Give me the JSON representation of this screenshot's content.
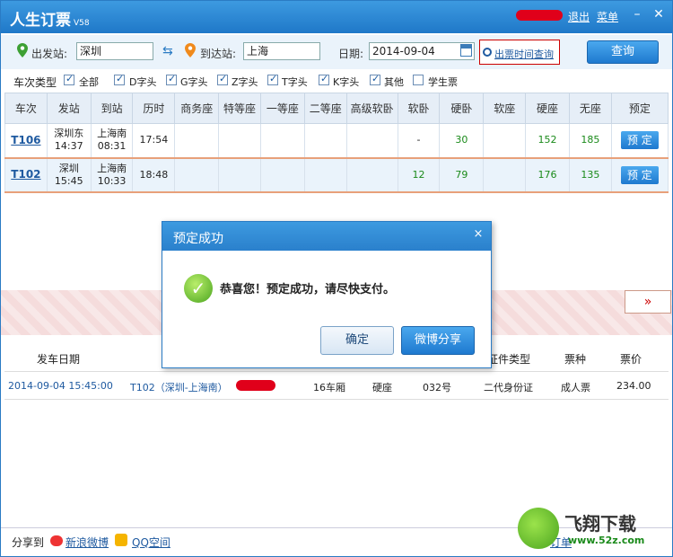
{
  "app": {
    "title": "人生订票",
    "version": "V58",
    "logout": "退出",
    "menu": "菜单"
  },
  "search": {
    "from_label": "出发站:",
    "from_value": "深圳",
    "to_label": "到达站:",
    "to_value": "上海",
    "date_label": "日期:",
    "date_value": "2014-09-04",
    "time_query": "出票时间查询",
    "query_btn": "查询"
  },
  "filter": {
    "label": "车次类型",
    "options": [
      {
        "label": "全部",
        "checked": true
      },
      {
        "label": "D字头",
        "checked": true
      },
      {
        "label": "G字头",
        "checked": true
      },
      {
        "label": "Z字头",
        "checked": true
      },
      {
        "label": "T字头",
        "checked": true
      },
      {
        "label": "K字头",
        "checked": true
      },
      {
        "label": "其他",
        "checked": true
      },
      {
        "label": "学生票",
        "checked": false
      }
    ]
  },
  "grid": {
    "headers": [
      "车次",
      "发站",
      "到站",
      "历时",
      "商务座",
      "特等座",
      "一等座",
      "二等座",
      "高级软卧",
      "软卧",
      "硬卧",
      "软座",
      "硬座",
      "无座",
      "预定"
    ],
    "rows": [
      {
        "train": "T106",
        "from": "深圳东",
        "from_time": "14:37",
        "to": "上海南",
        "to_time": "08:31",
        "duration": "17:54",
        "soft_sleeper": "-",
        "hard_sleeper": "30",
        "hard_seat": "152",
        "no_seat": "185",
        "book": "预 定"
      },
      {
        "train": "T102",
        "from": "深圳",
        "from_time": "15:45",
        "to": "上海南",
        "to_time": "10:33",
        "duration": "18:48",
        "soft_sleeper": "12",
        "hard_sleeper": "79",
        "hard_seat": "176",
        "no_seat": "135",
        "book": "预 定"
      }
    ]
  },
  "order": {
    "headers": {
      "date": "发车日期",
      "id_type": "证件类型",
      "ticket_type": "票种",
      "price": "票价"
    },
    "row": {
      "datetime": "2014-09-04 15:45:00",
      "train": "T102（深圳-上海南）",
      "car": "16车厢",
      "seat_class": "硬座",
      "seat_no": "032号",
      "id_type": "二代身份证",
      "ticket_type": "成人票",
      "price": "234.00"
    }
  },
  "footer": {
    "share_label": "分享到",
    "weibo": "新浪微博",
    "qzone": "QQ空间",
    "partial": "订单"
  },
  "watermark": {
    "name": "飞翔下载",
    "url": "www.52z.com"
  },
  "dialog": {
    "title": "预定成功",
    "close": "×",
    "message": "恭喜您！预定成功，请尽快支付。",
    "ok": "确定",
    "share": "微博分享"
  },
  "banner_toggle": "»"
}
